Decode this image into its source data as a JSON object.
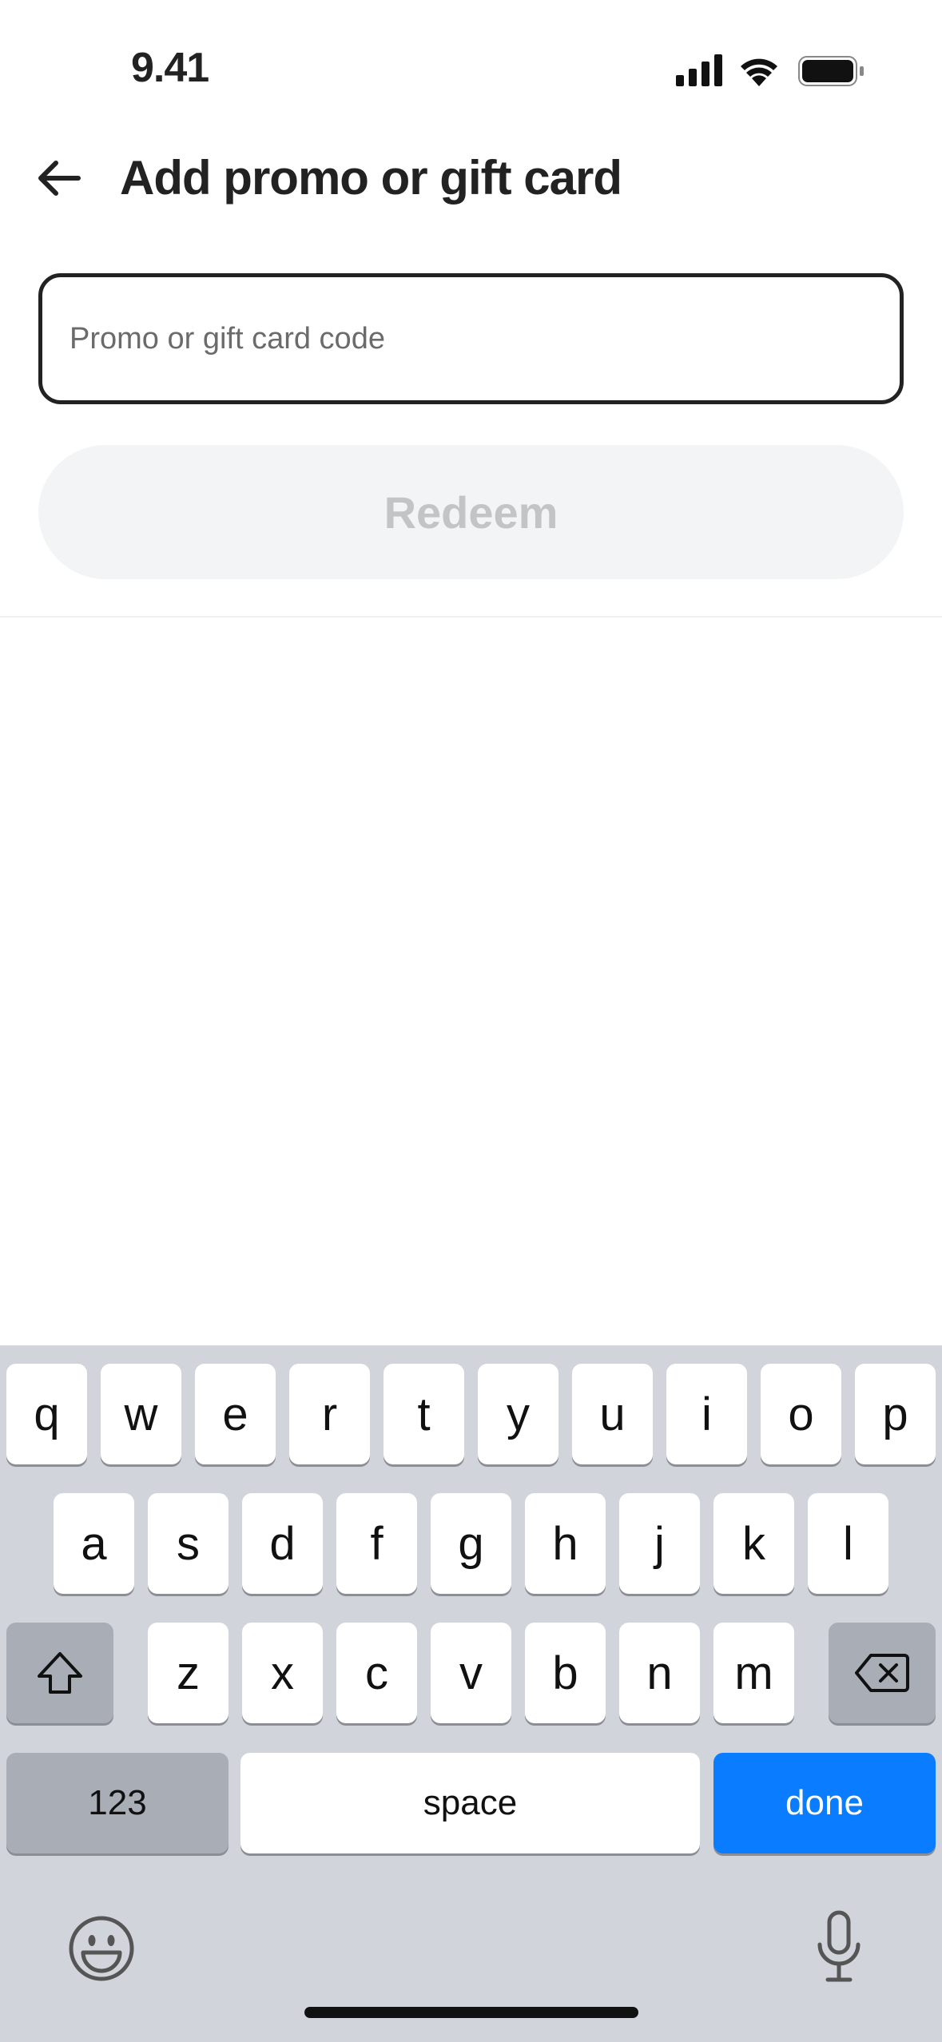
{
  "status_bar": {
    "time": "9.41"
  },
  "header": {
    "title": "Add promo or gift card"
  },
  "form": {
    "code_placeholder": "Promo or gift card code",
    "code_value": "",
    "redeem_label": "Redeem"
  },
  "keyboard": {
    "row1": [
      "q",
      "w",
      "e",
      "r",
      "t",
      "y",
      "u",
      "i",
      "o",
      "p"
    ],
    "row2": [
      "a",
      "s",
      "d",
      "f",
      "g",
      "h",
      "j",
      "k",
      "l"
    ],
    "row3": [
      "z",
      "x",
      "c",
      "v",
      "b",
      "n",
      "m"
    ],
    "numbers_label": "123",
    "space_label": "space",
    "done_label": "done"
  },
  "colors": {
    "accent": "#0a7cff",
    "keyboard_bg": "#d1d4db"
  }
}
